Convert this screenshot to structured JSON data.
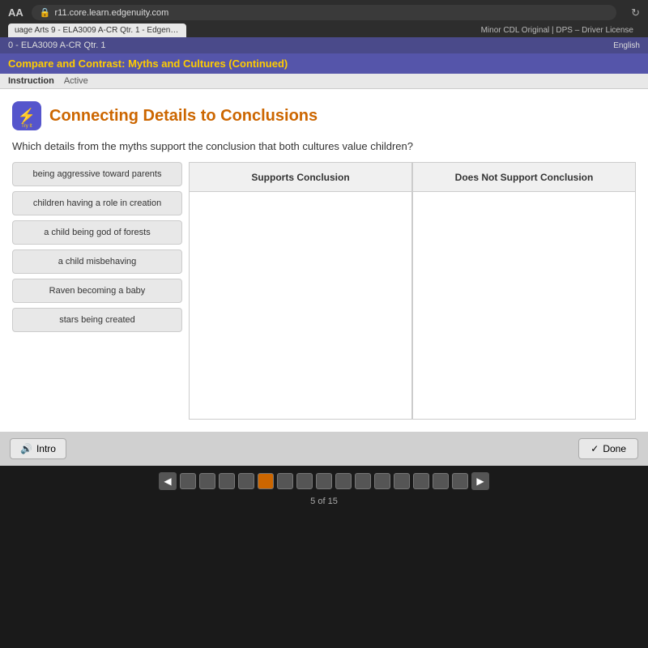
{
  "browser": {
    "aa_label": "AA",
    "url": "r11.core.learn.edgenuity.com",
    "tab1_label": "uage Arts 9 - ELA3009 A-CR Qtr. 1 - Edgenuity.com",
    "tab2_label": "Minor CDL Original | DPS – Driver License",
    "refresh_icon": "↻"
  },
  "app_header": {
    "course_label": "0 - ELA3009 A-CR Qtr. 1",
    "english_label": "English"
  },
  "page_title": {
    "text": "Compare and Contrast: Myths and Cultures (Continued)"
  },
  "instruction_bar": {
    "instruction_label": "Instruction",
    "active_label": "Active"
  },
  "activity": {
    "icon_symbol": "⚡",
    "icon_sublabel": "Try It",
    "title": "Connecting Details to Conclusions",
    "question": "Which details from the myths support the conclusion that both cultures value children?"
  },
  "drag_items": [
    {
      "id": 1,
      "text": "being aggressive toward parents"
    },
    {
      "id": 2,
      "text": "children having a role in creation"
    },
    {
      "id": 3,
      "text": "a child being god of forests"
    },
    {
      "id": 4,
      "text": "a child misbehaving"
    },
    {
      "id": 5,
      "text": "Raven becoming a baby"
    },
    {
      "id": 6,
      "text": "stars being created"
    }
  ],
  "drop_columns": [
    {
      "id": "supports",
      "header": "Supports Conclusion"
    },
    {
      "id": "does_not_support",
      "header": "Does Not Support Conclusion"
    }
  ],
  "controls": {
    "intro_icon": "🔊",
    "intro_label": "Intro",
    "done_icon": "✓",
    "done_label": "Done"
  },
  "pagination": {
    "prev_icon": "◀",
    "next_icon": "▶",
    "total_pages": 15,
    "current_page": 5,
    "page_count_label": "5 of 15"
  }
}
